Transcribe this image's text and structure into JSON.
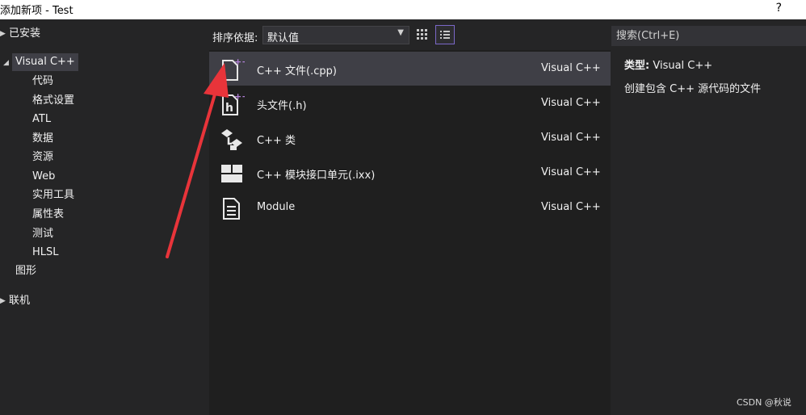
{
  "window": {
    "title": "添加新项 - Test",
    "help": "?"
  },
  "tree": {
    "installed": "已安装",
    "visual_cpp": "Visual C++",
    "children": [
      "代码",
      "格式设置",
      "ATL",
      "数据",
      "资源",
      "Web",
      "实用工具",
      "属性表",
      "测试",
      "HLSL"
    ],
    "graphics": "图形",
    "online": "联机"
  },
  "toolbar": {
    "sort_label": "排序依据:",
    "sort_value": "默认值"
  },
  "templates": [
    {
      "name": "C++ 文件(.cpp)",
      "lang": "Visual C++",
      "icon": "cpp-file-icon"
    },
    {
      "name": "头文件(.h)",
      "lang": "Visual C++",
      "icon": "header-file-icon"
    },
    {
      "name": "C++ 类",
      "lang": "Visual C++",
      "icon": "class-icon"
    },
    {
      "name": "C++ 模块接口单元(.ixx)",
      "lang": "Visual C++",
      "icon": "module-interface-icon"
    },
    {
      "name": "Module",
      "lang": "Visual C++",
      "icon": "module-icon"
    }
  ],
  "search": {
    "placeholder": "搜索(Ctrl+E)"
  },
  "info": {
    "type_label": "类型:",
    "type_value": "Visual C++",
    "description": "创建包含 C++ 源代码的文件"
  },
  "watermark": "CSDN @秋说",
  "colors": {
    "accent": "#7b68c8",
    "plus": "#b180d7",
    "annotation_arrow": "#e8343a"
  }
}
